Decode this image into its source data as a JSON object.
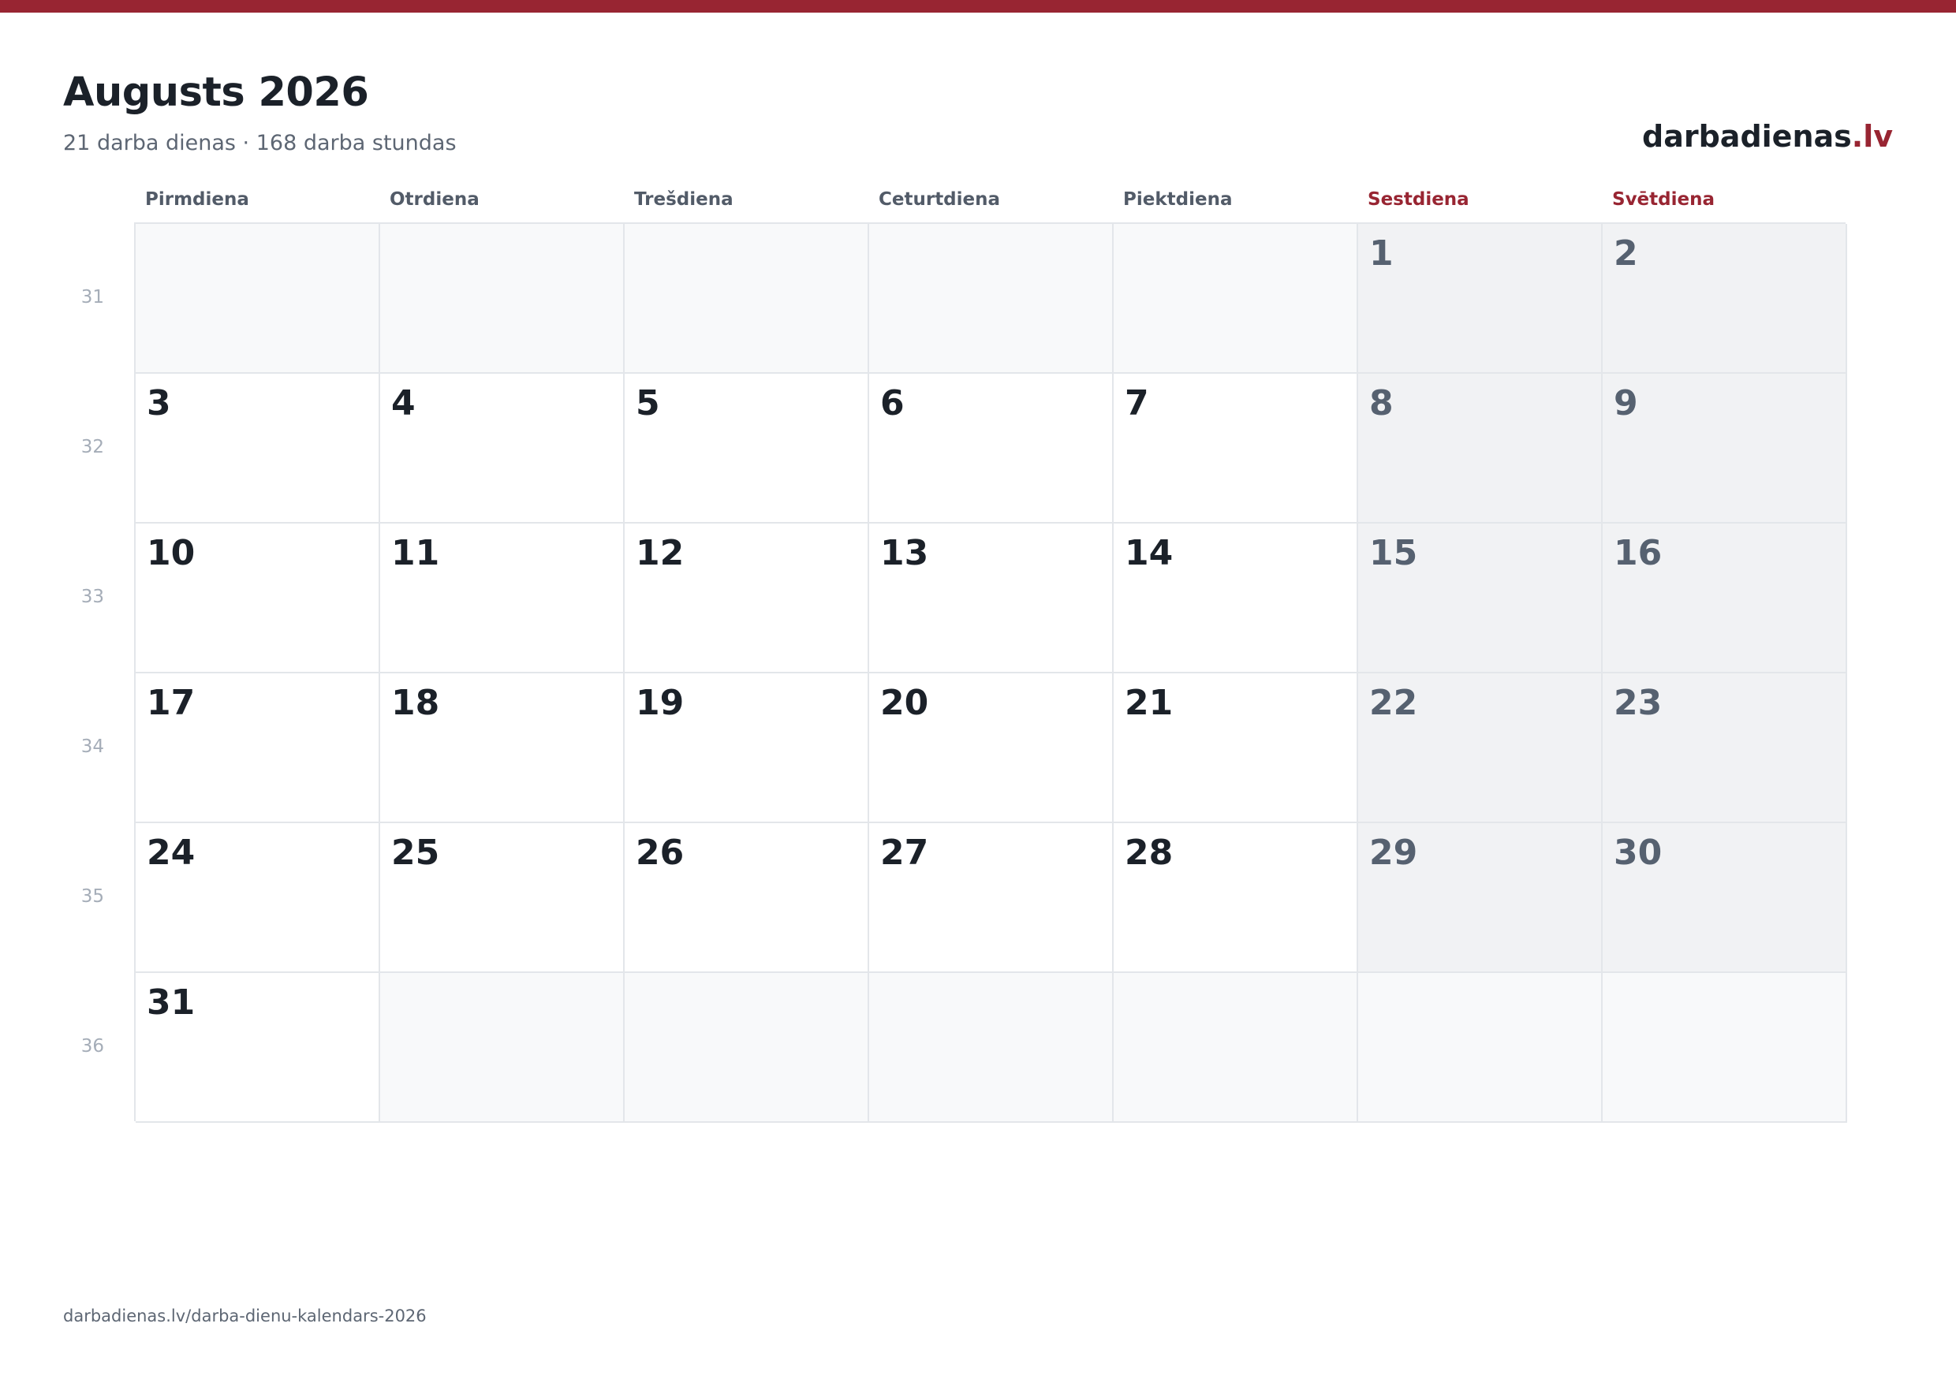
{
  "header": {
    "title": "Augusts 2026",
    "subtitle": "21 darba dienas · 168 darba stundas",
    "brand_name": "darbadienas",
    "brand_tld": ".lv"
  },
  "weekdays": [
    "Pirmdiena",
    "Otrdiena",
    "Trešdiena",
    "Ceturtdiena",
    "Piektdiena",
    "Sestdiena",
    "Svētdiena"
  ],
  "weekend_columns": [
    5,
    6
  ],
  "weeks": [
    {
      "number": "31",
      "days": [
        "",
        "",
        "",
        "",
        "",
        "1",
        "2"
      ]
    },
    {
      "number": "32",
      "days": [
        "3",
        "4",
        "5",
        "6",
        "7",
        "8",
        "9"
      ]
    },
    {
      "number": "33",
      "days": [
        "10",
        "11",
        "12",
        "13",
        "14",
        "15",
        "16"
      ]
    },
    {
      "number": "34",
      "days": [
        "17",
        "18",
        "19",
        "20",
        "21",
        "22",
        "23"
      ]
    },
    {
      "number": "35",
      "days": [
        "24",
        "25",
        "26",
        "27",
        "28",
        "29",
        "30"
      ]
    },
    {
      "number": "36",
      "days": [
        "31",
        "",
        "",
        "",
        "",
        "",
        ""
      ]
    }
  ],
  "footer": {
    "url": "darbadienas.lv/darba-dienu-kalendars-2026"
  },
  "colors": {
    "accent": "#982532",
    "text_dark": "#1b2129",
    "weekend_bg": "#f1f2f4",
    "empty_bg": "#f8f9fa"
  }
}
